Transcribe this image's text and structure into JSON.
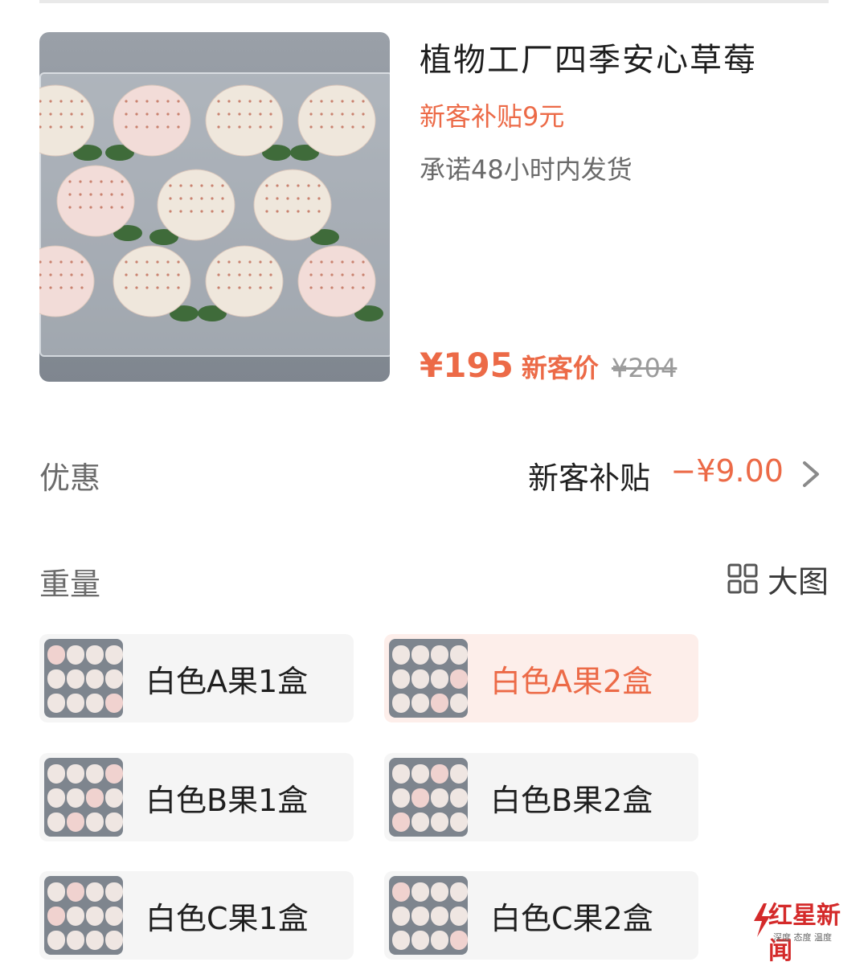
{
  "product": {
    "title": "植物工厂四季安心草莓",
    "subsidy": "新客补贴9元",
    "shipping": "承诺48小时内发货",
    "price": "¥195",
    "price_tag": "新客价",
    "original_price": "¥204"
  },
  "discount": {
    "label": "优惠",
    "name": "新客补贴",
    "amount": "−¥9.00"
  },
  "weight": {
    "label": "重量",
    "big_view_label": "大图",
    "options": [
      {
        "label": "白色A果1盒",
        "selected": false
      },
      {
        "label": "白色A果2盒",
        "selected": true
      },
      {
        "label": "白色B果1盒",
        "selected": false
      },
      {
        "label": "白色B果2盒",
        "selected": false
      },
      {
        "label": "白色C果1盒",
        "selected": false
      },
      {
        "label": "白色C果2盒",
        "selected": false
      }
    ]
  },
  "watermark": {
    "text": "红星新闻",
    "sub": "深度 态度 温度"
  },
  "colors": {
    "accent": "#ec6a47",
    "selected_bg": "#fdeeea",
    "card_bg": "#f5f5f5"
  }
}
